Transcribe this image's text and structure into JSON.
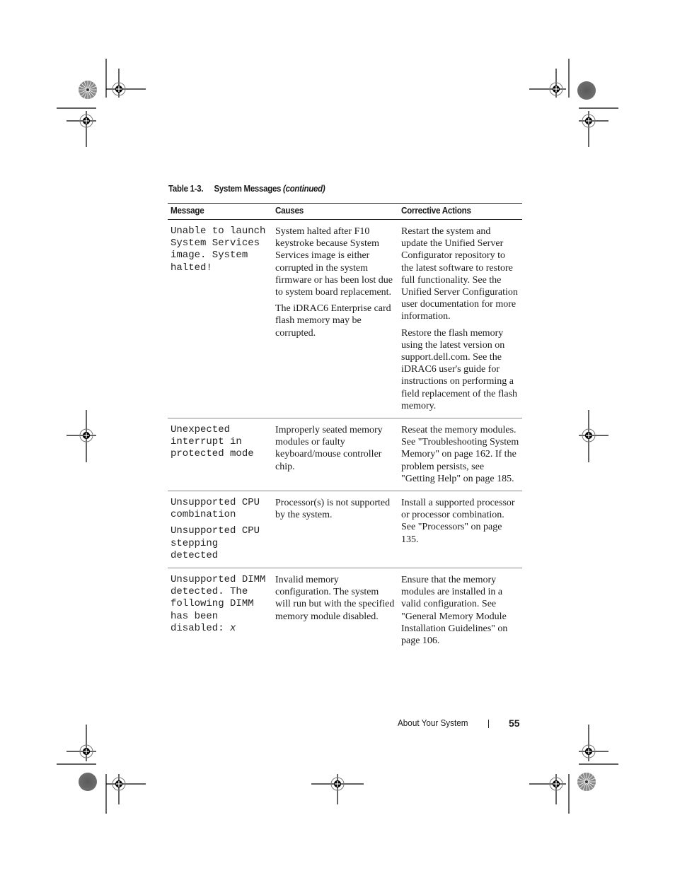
{
  "table": {
    "number": "Table 1-3.",
    "title": "System Messages",
    "continued": "(continued)",
    "headers": [
      "Message",
      "Causes",
      "Corrective Actions"
    ],
    "rows": [
      {
        "message": [
          "Unable to launch System Services image. System halted!"
        ],
        "causes": [
          "System halted after F10 keystroke because System Services image is either corrupted in the system firmware or has been lost due to system board replacement.",
          "The iDRAC6 Enterprise card flash memory may be corrupted."
        ],
        "actions": [
          "Restart the system and update the Unified Server Configurator repository to the latest software to restore full functionality. See the Unified Server Configuration user documentation for more information.",
          "Restore the flash memory using the latest version on support.dell.com. See the iDRAC6 user's guide for instructions on performing a field replacement of the flash memory."
        ]
      },
      {
        "message": [
          "Unexpected interrupt in protected mode"
        ],
        "causes": [
          "Improperly seated memory modules or faulty keyboard/mouse controller chip."
        ],
        "actions": [
          "Reseat the memory modules. See \"Troubleshooting System Memory\" on page 162. If the problem persists, see \"Getting Help\" on page 185."
        ]
      },
      {
        "message": [
          "Unsupported CPU combination",
          "Unsupported CPU stepping detected"
        ],
        "causes": [
          "Processor(s) is not supported by the system."
        ],
        "actions": [
          "Install a supported processor or processor combination. See \"Processors\" on page 135."
        ]
      },
      {
        "message": [
          "Unsupported DIMM detected. The following DIMM has been disabled: "
        ],
        "message_variable": "x",
        "causes": [
          "Invalid memory configuration. The system will run but with the specified memory module disabled."
        ],
        "actions": [
          "Ensure that the memory modules are installed in a valid configuration. See \"General Memory Module Installation Guidelines\" on page 106."
        ]
      }
    ]
  },
  "footer": {
    "section": "About Your System",
    "page_number": "55"
  },
  "registration_marks": {
    "crosshair_icon": "registration-crosshair-icon",
    "star_target_icon": "star-target-icon",
    "gray_disc_icon": "gray-disc-icon"
  }
}
